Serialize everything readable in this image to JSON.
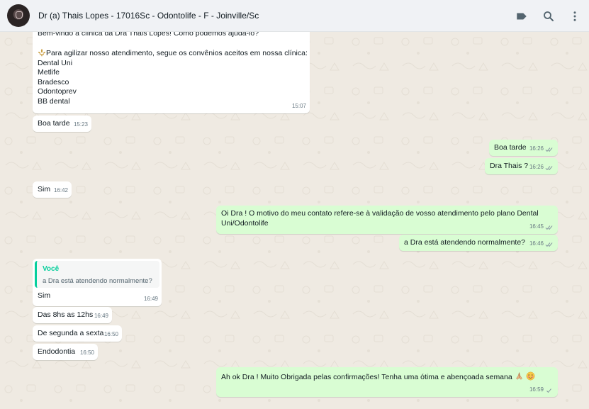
{
  "header": {
    "title": "Dr (a) Thais Lopes - 17016Sc - Odontolife - F - Joinville/Sc",
    "icons": [
      "label-icon",
      "search-icon",
      "menu-icon"
    ]
  },
  "messages": {
    "welcome": {
      "lines": [
        "Bem-vindo a clínica da Dra Thais Lopes! Como podemos ajudá-lo?",
        "",
        "Para agilizar nosso atendimento, segue os convênios aceitos em nossa clínica:",
        "Dental Uni",
        "Metlife",
        "Bradesco",
        "Odontoprev",
        "BB dental"
      ],
      "time": "15:07"
    },
    "m1": {
      "text": "Boa tarde",
      "time": "15:23"
    },
    "m2": {
      "text": "Boa tarde",
      "time": "16:26"
    },
    "m3": {
      "text": "Dra Thais ?",
      "time": "16:26"
    },
    "m4": {
      "text": "Sim",
      "time": "16:42"
    },
    "m5": {
      "line1": "Oi Dra ! O motivo do meu contato refere-se à validação de vosso atendimento pelo plano Dental",
      "line2": "Uni/Odontolife",
      "time": "16:45"
    },
    "m6": {
      "text": "a Dra está atendendo normalmente?",
      "time": "16:46"
    },
    "m7": {
      "quote_author": "Você",
      "quote_text": "a Dra está atendendo normalmente?",
      "text": "Sim",
      "time": "16:49"
    },
    "m8": {
      "text": "Das 8hs as 12hs",
      "time": "16:49"
    },
    "m9": {
      "text": "De segunda a sexta",
      "time": "16:50"
    },
    "m10": {
      "text": "Endodontia",
      "time": "16:50"
    },
    "m11": {
      "text": "Ah ok Dra ! Muito Obrigada pelas confirmações! Tenha uma ótima e abençoada semana",
      "time": "16:59"
    }
  },
  "colors": {
    "incoming": "#ffffff",
    "outgoing": "#d9fdd3",
    "read_ticks": "#53bdeb",
    "quote_accent": "#06cf9c"
  }
}
